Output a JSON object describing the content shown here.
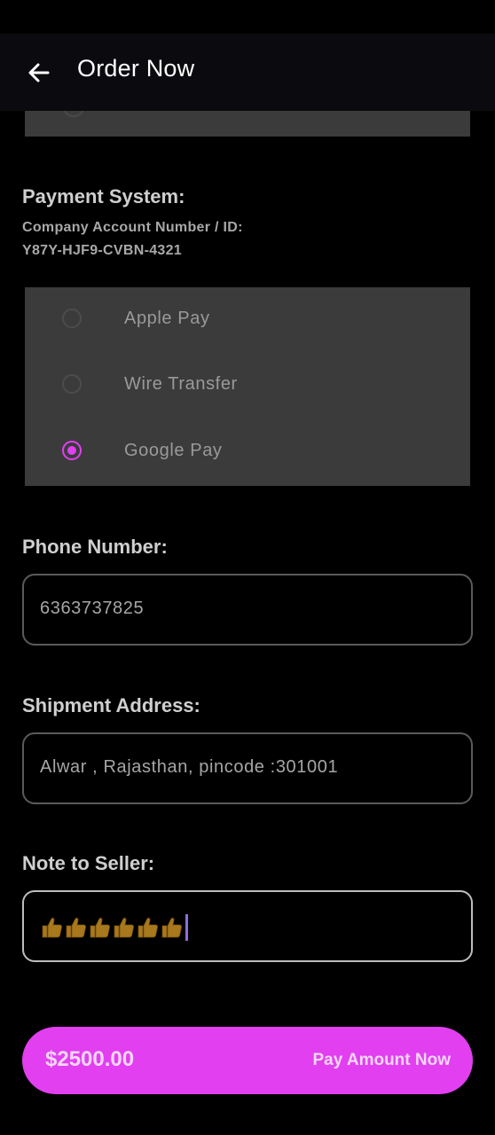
{
  "app_bar": {
    "title": "Order Now",
    "back_icon": "arrow-left-icon"
  },
  "payment": {
    "section_title": "Payment System:",
    "account_label": "Company Account Number / ID:",
    "account_id": "Y87Y-HJF9-CVBN-4321",
    "options": [
      {
        "label": "Apple Pay",
        "selected": false
      },
      {
        "label": "Wire Transfer",
        "selected": false
      },
      {
        "label": "Google Pay",
        "selected": true
      }
    ]
  },
  "phone": {
    "label": "Phone Number:",
    "value": "6363737825"
  },
  "shipment": {
    "label": "Shipment Address:",
    "value": "Alwar , Rajasthan, pincode :301001"
  },
  "note": {
    "label": "Note to Seller:",
    "value": "👍👍👍👍👍👍",
    "emoji_icon": "thumbs-up-icon",
    "emoji_count": 6
  },
  "pay_button": {
    "amount": "$2500.00",
    "label": "Pay Amount Now"
  },
  "colors": {
    "accent": "#e13ff0",
    "background": "#000000",
    "card": "#3b3b3b",
    "app_bar": "#0b0a0e"
  }
}
